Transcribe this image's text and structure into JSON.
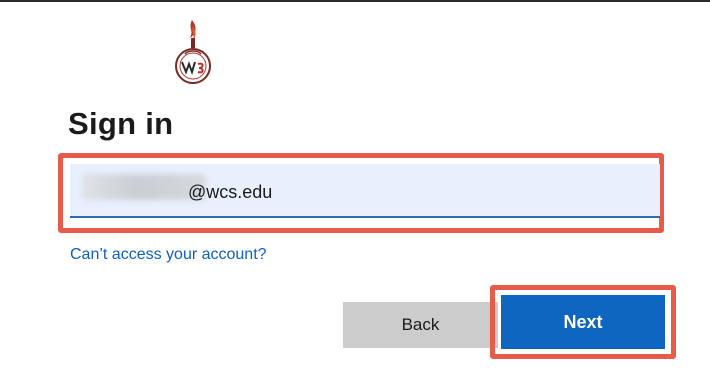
{
  "title": "Sign in",
  "email": {
    "value": "@wcs.edu"
  },
  "help_link": "Can’t access your account?",
  "buttons": {
    "back": "Back",
    "next": "Next"
  },
  "colors": {
    "accent": "#0f66c0",
    "highlight": "#e85b4a",
    "input_bg": "#e8f0fe"
  }
}
